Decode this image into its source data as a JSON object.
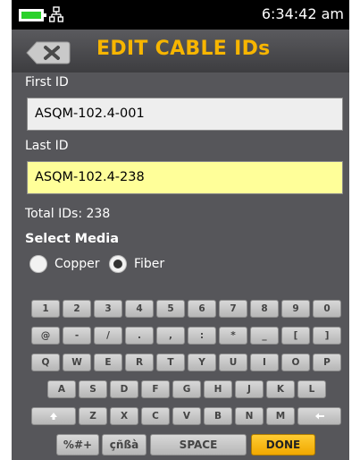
{
  "status_bar": {
    "time": "6:34:42 am",
    "battery_color": "#2bd12b",
    "icons": [
      "battery-icon",
      "network-icon"
    ]
  },
  "title_bar": {
    "title": "EDIT CABLE IDs",
    "back_icon": "close-icon",
    "title_color": "#f7b500"
  },
  "form": {
    "first_id_label": "First ID",
    "first_id_value": "ASQM-102.4-001",
    "last_id_label": "Last ID",
    "last_id_value": "ASQM-102.4-238",
    "total_ids": "Total IDs: 238",
    "select_media_label": "Select Media",
    "media_options": [
      {
        "label": "Copper",
        "selected": false
      },
      {
        "label": "Fiber",
        "selected": true
      }
    ]
  },
  "keyboard": {
    "rows": [
      [
        "1",
        "2",
        "3",
        "4",
        "5",
        "6",
        "7",
        "8",
        "9",
        "0"
      ],
      [
        "@",
        "-",
        "/",
        ".",
        ",",
        ":",
        "*",
        "_",
        "[",
        "]"
      ],
      [
        "Q",
        "W",
        "E",
        "R",
        "T",
        "Y",
        "U",
        "I",
        "O",
        "P"
      ],
      [
        "A",
        "S",
        "D",
        "F",
        "G",
        "H",
        "J",
        "K",
        "L"
      ],
      [
        "Z",
        "X",
        "C",
        "V",
        "B",
        "N",
        "M"
      ]
    ],
    "shift_icon": "shift-up-icon",
    "backspace_icon": "backspace-icon",
    "symbols_label": "%#+",
    "accents_label": "çñßà",
    "space_label": "SPACE",
    "done_label": "DONE",
    "done_color": "#f7b500"
  }
}
